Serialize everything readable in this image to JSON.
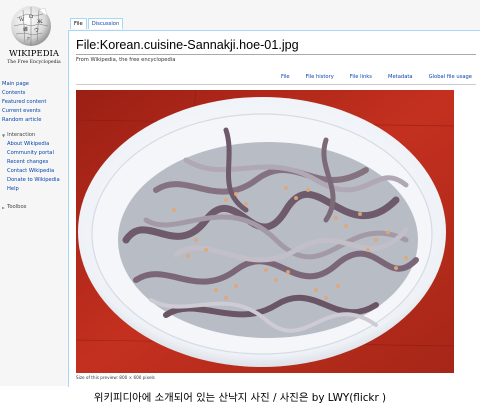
{
  "logo": {
    "wordmark": "WIKIPEDIA",
    "tagline": "The Free Encyclopedia"
  },
  "nav": {
    "main": [
      "Main page",
      "Contents",
      "Featured content",
      "Current events",
      "Random article"
    ],
    "interaction": {
      "heading": "Interaction",
      "items": [
        "About Wikipedia",
        "Community portal",
        "Recent changes",
        "Contact Wikipedia",
        "Donate to Wikipedia",
        "Help"
      ]
    },
    "toolbox": {
      "heading": "Toolbox"
    }
  },
  "tabs": [
    "File",
    "Discussion"
  ],
  "page": {
    "title": "File:Korean.cuisine-Sannakji.hoe-01.jpg",
    "subtitle": "From Wikipedia, the free encyclopedia",
    "file_tabs": [
      "File",
      "File history",
      "File links",
      "Metadata",
      "Global file usage"
    ],
    "preview_note": "Size of this preview: 800 × 600 pixels"
  },
  "photo": {
    "subject": "Sannakji (live octopus) on a white oval plate with sesame seeds, on a red table"
  },
  "bottom_caption": "위키피디아에 소개되어 있는 산낙지 사진 / 사진은 by LWY(flickr )",
  "colors": {
    "link": "#0645ad",
    "border": "#a7d7f9",
    "sidebar_bg": "#f6f6f6",
    "table_red": "#b32a1c"
  }
}
